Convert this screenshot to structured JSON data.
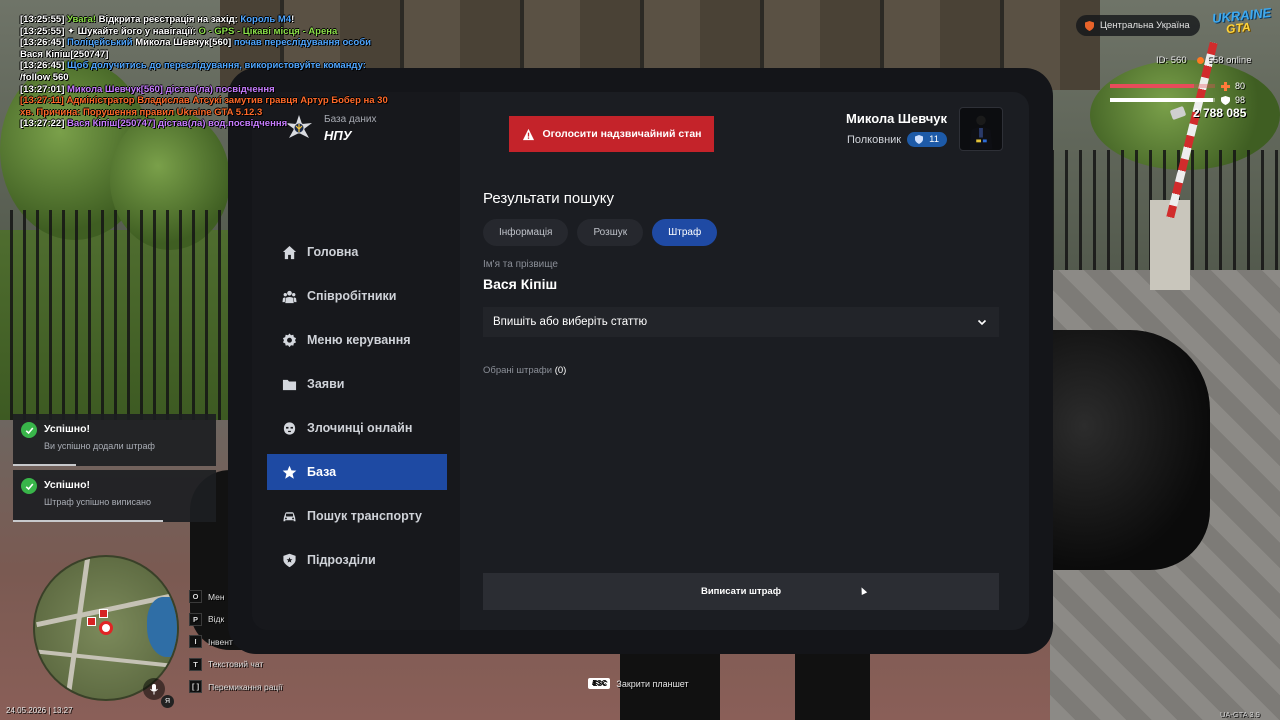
{
  "chat": [
    {
      "parts": [
        {
          "t": "[13:25:55] ",
          "c": "#ffffff"
        },
        {
          "t": "Увага! ",
          "c": "#8de04a"
        },
        {
          "t": "Відкрита реєстрація на захід: ",
          "c": "#ffffff"
        },
        {
          "t": "Король М4",
          "c": "#4fa6ff"
        },
        {
          "t": "!",
          "c": "#ffffff"
        }
      ]
    },
    {
      "parts": [
        {
          "t": "[13:25:55] ",
          "c": "#ffffff"
        },
        {
          "t": "✦ ",
          "c": "#ffffff"
        },
        {
          "t": "Шукайте його у навігації: ",
          "c": "#ffffff"
        },
        {
          "t": "O - GPS - Цікаві місця - Арена",
          "c": "#8de04a"
        }
      ]
    },
    {
      "parts": [
        {
          "t": "[13:26:45] ",
          "c": "#ffffff"
        },
        {
          "t": "Поліцейський ",
          "c": "#4fa6ff"
        },
        {
          "t": "Микола Шевчук[560] ",
          "c": "#ffffff"
        },
        {
          "t": "почав переслідування особи",
          "c": "#4fa6ff"
        }
      ]
    },
    {
      "parts": [
        {
          "t": "Вася Кіпіш[250747]",
          "c": "#ffffff"
        }
      ]
    },
    {
      "parts": [
        {
          "t": "[13:26:45] ",
          "c": "#ffffff"
        },
        {
          "t": "Щоб долучитись до переслідування, використовуйте команду:",
          "c": "#4fa6ff"
        }
      ]
    },
    {
      "parts": [
        {
          "t": "/follow 560",
          "c": "#ffffff"
        }
      ]
    },
    {
      "parts": [
        {
          "t": "[13:27:01] ",
          "c": "#ffffff"
        },
        {
          "t": "Микола Шевчук[560] дістав(ла) посвідчення",
          "c": "#c77dff"
        }
      ]
    },
    {
      "parts": [
        {
          "t": "[13:27:11] ",
          "c": "#ff6a2a"
        },
        {
          "t": "Адміністратор Владислав Атсукі замутив гравця Артур Бобер на 30",
          "c": "#ff6a2a"
        }
      ]
    },
    {
      "parts": [
        {
          "t": " хв. Причина: Порушення правил Ukraine GTA 5.12.3",
          "c": "#ff6a2a"
        }
      ]
    },
    {
      "parts": [
        {
          "t": "[13:27:22] ",
          "c": "#ffffff"
        },
        {
          "t": "Вася Кіпіш[250747] дістав(ла) вод.посвідчення",
          "c": "#c77dff"
        }
      ]
    }
  ],
  "brand": {
    "subtitle": "База даних",
    "name": "НПУ"
  },
  "alert": {
    "label": "Оголосити надзвичайний стан"
  },
  "user": {
    "name": "Микола Шевчук",
    "rank": "Полковник",
    "level": "11"
  },
  "nav": [
    {
      "label": "Головна",
      "icon": "home-icon",
      "active": false
    },
    {
      "label": "Співробітники",
      "icon": "people-icon",
      "active": false
    },
    {
      "label": "Меню керування",
      "icon": "gear-icon",
      "active": false
    },
    {
      "label": "Заяви",
      "icon": "folder-icon",
      "active": false
    },
    {
      "label": "Злочинці онлайн",
      "icon": "mask-icon",
      "active": false
    },
    {
      "label": "База",
      "icon": "star-icon",
      "active": true
    },
    {
      "label": "Пошук транспорту",
      "icon": "car-icon",
      "active": false
    },
    {
      "label": "Підрозділи",
      "icon": "shield-icon",
      "active": false
    }
  ],
  "results": {
    "title": "Результати пошуку",
    "tabs": [
      {
        "label": "Інформація",
        "active": false
      },
      {
        "label": "Розшук",
        "active": false
      },
      {
        "label": "Штраф",
        "active": true
      }
    ],
    "name_label": "Ім'я та прізвище",
    "name_value": "Вася Кіпіш",
    "select_placeholder": "Впишіть або виберіть статтю",
    "chosen_label": "Обрані штрафи",
    "chosen_count": "(0)",
    "issue_button": "Виписати штраф"
  },
  "notifications": [
    {
      "title": "Успішно!",
      "text": "Ви успішно додали штраф",
      "progress": 0.31
    },
    {
      "title": "Успішно!",
      "text": "Штраф успішно виписано",
      "progress": 0.74
    }
  ],
  "hints": [
    {
      "key": "O",
      "label": "Мен"
    },
    {
      "key": "P",
      "label": "Відк"
    },
    {
      "key": "I",
      "label": "Інвент"
    },
    {
      "key": "T",
      "label": "Текстовий чат"
    },
    {
      "key": "[ ]",
      "label": "Перемикання рації"
    }
  ],
  "esc": {
    "key": "ESC",
    "label": "Закрити планшет"
  },
  "clock": "24.05.2026 | 13:27",
  "lang": "Я",
  "hud": {
    "region": "Центральна Україна",
    "logo_top": "UKRAINE",
    "logo_bottom": "GTA",
    "id": "ID: 560",
    "online": "558 online",
    "health": "80",
    "armor": "98",
    "money": "2 788 085",
    "version": "UA-GTA 3.9"
  },
  "colors": {
    "accent": "#1e4aa3",
    "danger": "#c4232a",
    "success": "#39b54a",
    "panel": "#1b1d22"
  }
}
